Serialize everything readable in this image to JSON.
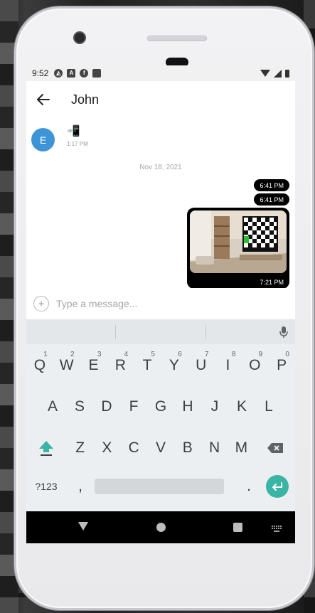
{
  "status_bar": {
    "time": "9:52",
    "icons": [
      "android-icon",
      "a-icon",
      "f-icon",
      "sd-card-icon"
    ]
  },
  "app_bar": {
    "title": "John"
  },
  "chat": {
    "avatar_initial": "E",
    "incoming_message": {
      "content": "📲",
      "time": "1:17 PM"
    },
    "date_separator": "Nov 18, 2021",
    "outgoing_messages": [
      {
        "time": "6:41 PM"
      },
      {
        "time": "6:41 PM"
      }
    ],
    "image_message": {
      "time": "7:21 PM"
    }
  },
  "composer": {
    "placeholder": "Type a message..."
  },
  "keyboard": {
    "row1": [
      {
        "key": "Q",
        "hint": "1"
      },
      {
        "key": "W",
        "hint": "2"
      },
      {
        "key": "E",
        "hint": "3"
      },
      {
        "key": "R",
        "hint": "4"
      },
      {
        "key": "T",
        "hint": "5"
      },
      {
        "key": "Y",
        "hint": "6"
      },
      {
        "key": "U",
        "hint": "7"
      },
      {
        "key": "I",
        "hint": "8"
      },
      {
        "key": "O",
        "hint": "9"
      },
      {
        "key": "P",
        "hint": "0"
      }
    ],
    "row2": [
      "A",
      "S",
      "D",
      "F",
      "G",
      "H",
      "J",
      "K",
      "L"
    ],
    "row3": [
      "Z",
      "X",
      "C",
      "V",
      "B",
      "N",
      "M"
    ],
    "symbols_label": "?123",
    "comma": ",",
    "period": "."
  },
  "colors": {
    "avatar": "#3d95d8",
    "enter_key": "#3ab4a5",
    "bubble": "#000000"
  }
}
